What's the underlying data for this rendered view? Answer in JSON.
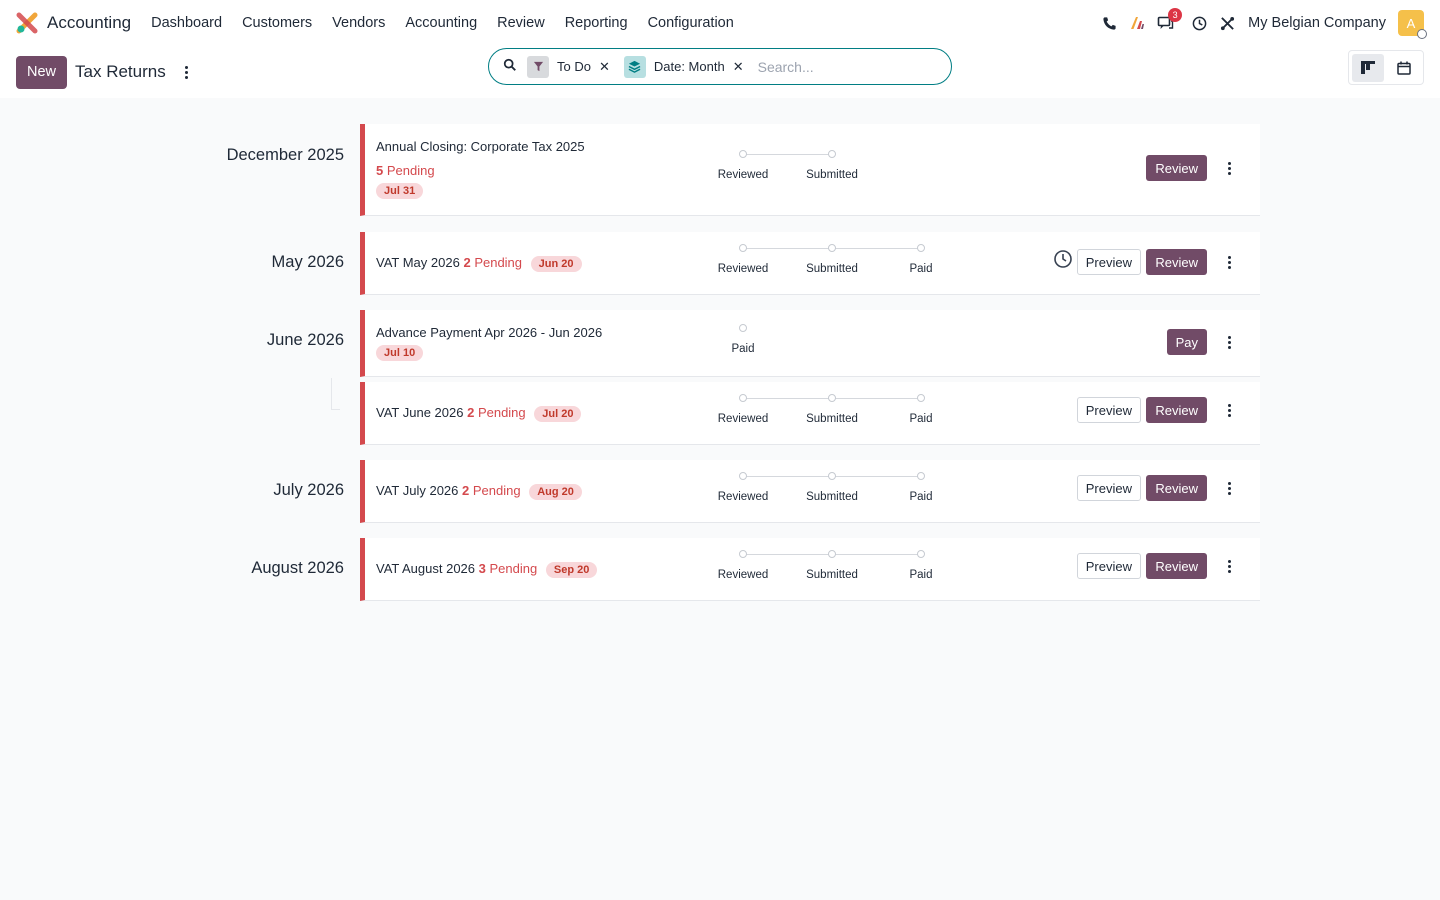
{
  "navbar": {
    "app_name": "Accounting",
    "menu": [
      "Dashboard",
      "Customers",
      "Vendors",
      "Accounting",
      "Review",
      "Reporting",
      "Configuration"
    ],
    "messages_count": "3",
    "company": "My Belgian Company",
    "avatar_letter": "A"
  },
  "control": {
    "new_label": "New",
    "title": "Tax Returns",
    "search": {
      "facets": [
        "To Do",
        "Date: Month"
      ],
      "placeholder": "Search..."
    }
  },
  "months": [
    "December 2025",
    "May 2026",
    "June 2026",
    "July 2026",
    "August 2026"
  ],
  "returns": [
    {
      "name": "Annual Closing: Corporate Tax 2025",
      "pending_count": "5",
      "pending_label": "Pending",
      "deadline": "Jul 31",
      "steps": [
        "Reviewed",
        "Submitted"
      ],
      "primary_action": "Review"
    },
    {
      "name": "VAT May 2026",
      "pending_count": "2",
      "pending_label": "Pending",
      "deadline": "Jun 20",
      "steps": [
        "Reviewed",
        "Submitted",
        "Paid"
      ],
      "secondary_action": "Preview",
      "primary_action": "Review"
    },
    {
      "name": "Advance Payment Apr 2026 - Jun 2026",
      "deadline": "Jul 10",
      "steps": [
        "Paid"
      ],
      "primary_action": "Pay"
    },
    {
      "name": "VAT June 2026",
      "pending_count": "2",
      "pending_label": "Pending",
      "deadline": "Jul 20",
      "steps": [
        "Reviewed",
        "Submitted",
        "Paid"
      ],
      "secondary_action": "Preview",
      "primary_action": "Review"
    },
    {
      "name": "VAT July 2026",
      "pending_count": "2",
      "pending_label": "Pending",
      "deadline": "Aug 20",
      "steps": [
        "Reviewed",
        "Submitted",
        "Paid"
      ],
      "secondary_action": "Preview",
      "primary_action": "Review"
    },
    {
      "name": "VAT August 2026",
      "pending_count": "3",
      "pending_label": "Pending",
      "deadline": "Sep 20",
      "steps": [
        "Reviewed",
        "Submitted",
        "Paid"
      ],
      "secondary_action": "Preview",
      "primary_action": "Review"
    }
  ],
  "colors": {
    "brand": "#714b67",
    "overdue": "#d4494d",
    "search_border": "#017e84"
  }
}
